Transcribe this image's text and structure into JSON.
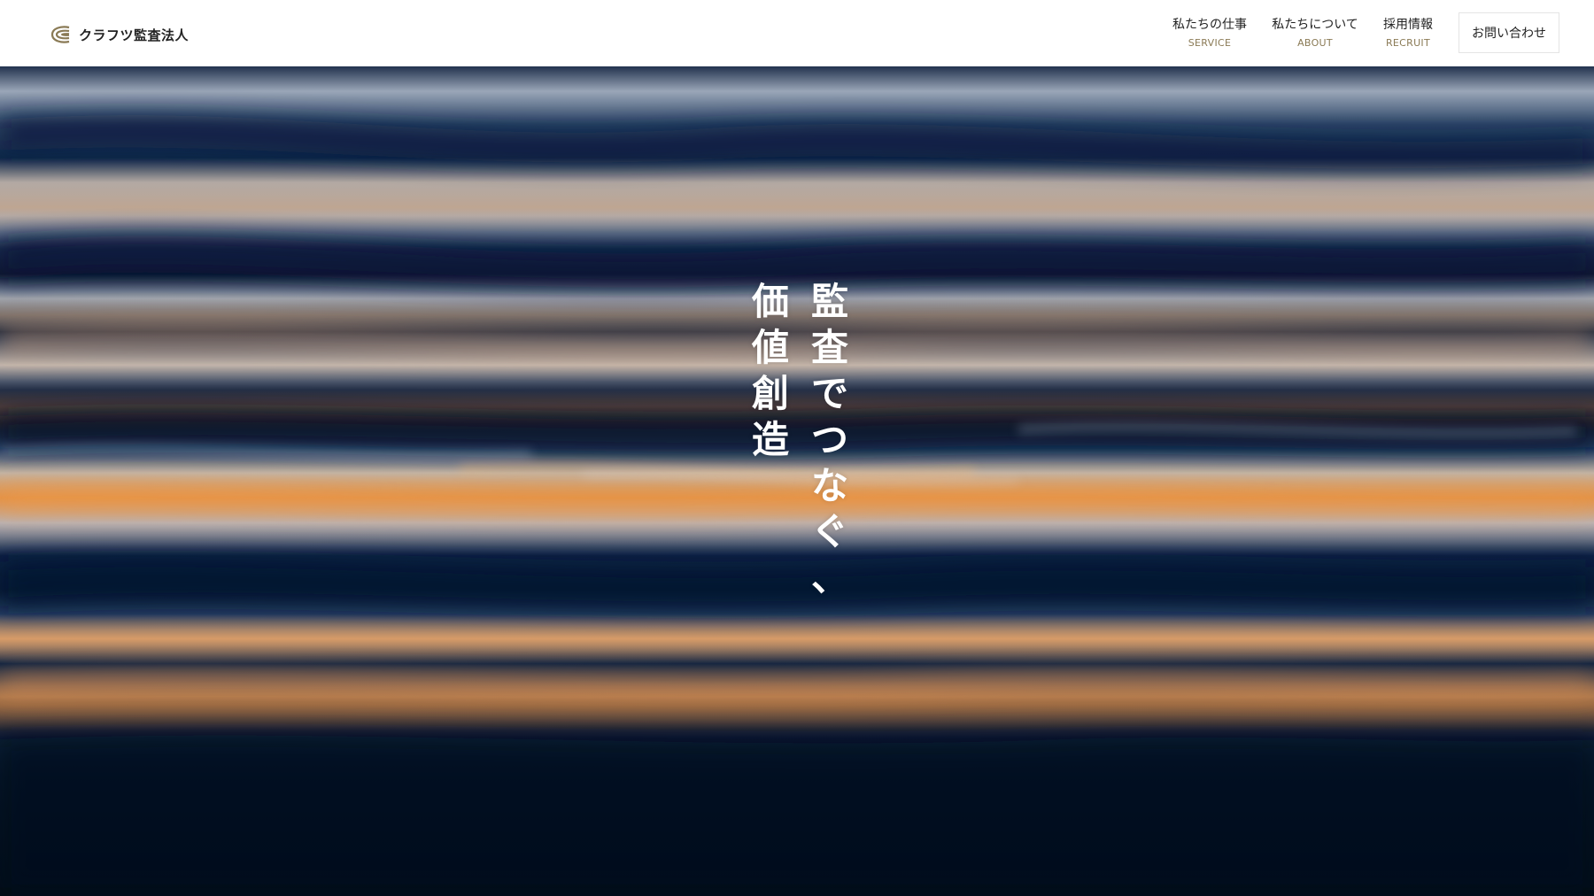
{
  "header": {
    "logo": {
      "icon": "crafts-logo-icon",
      "text": "クラフツ監査法人",
      "brand_color": "#8a7a55"
    },
    "nav": [
      {
        "label": "私たちの仕事",
        "sub_label": "SERVICE"
      },
      {
        "label": "私たちについて",
        "sub_label": "ABOUT"
      },
      {
        "label": "採用情報",
        "sub_label": "RECRUIT"
      }
    ],
    "contact_label": "お問い合わせ"
  },
  "hero": {
    "background": "blurred-water-ripples-image",
    "tagline": {
      "line1": "監査でつなぐ、",
      "line2": "価値創造"
    },
    "colors": {
      "deep_blue": "#0a1e3c",
      "amber": "#e69a4f",
      "text": "#ffffff"
    }
  }
}
